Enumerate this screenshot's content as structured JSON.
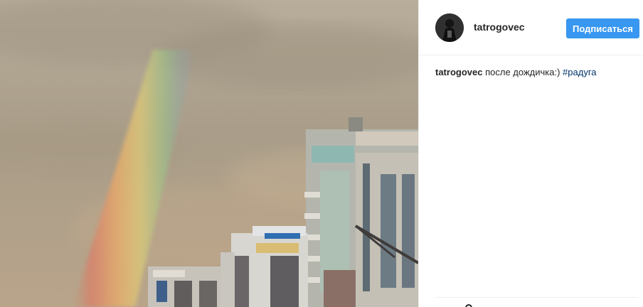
{
  "post": {
    "username": "tatrogovec",
    "follow_label": "Подписаться",
    "caption": {
      "user": "tatrogovec",
      "text": "после дождичка:)",
      "hashtag": "#радуга"
    }
  },
  "icons": {
    "avatar": "profile-avatar",
    "footer": "comment-icon"
  },
  "colors": {
    "accent": "#3897f0",
    "hashtag": "#003569",
    "text": "#262626",
    "divider": "#efefef"
  }
}
